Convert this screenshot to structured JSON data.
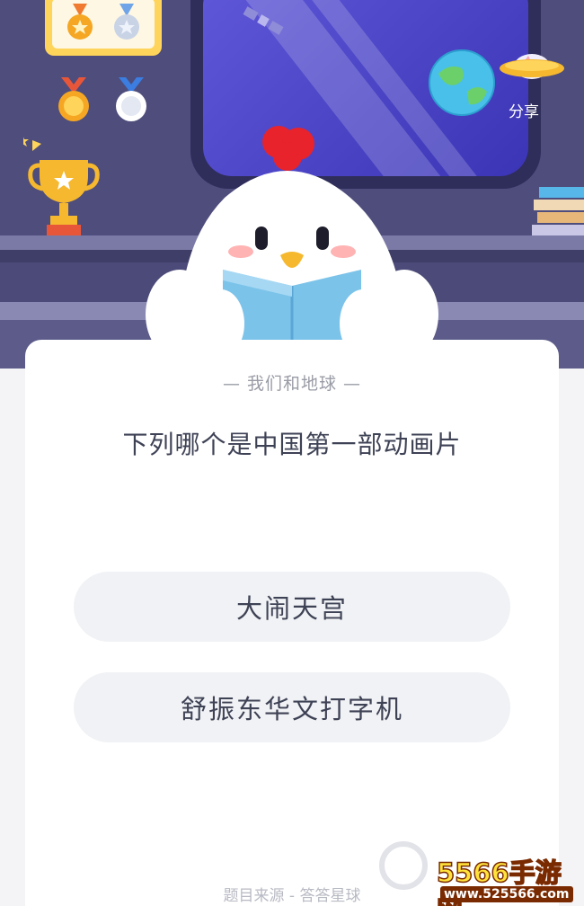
{
  "scene": {
    "share_label": "分享",
    "icons": [
      "bronze-medal-icon",
      "silver-medal-icon",
      "trophy-icon",
      "earth-icon",
      "ufo-icon",
      "satellite-icon",
      "books-icon"
    ]
  },
  "quiz": {
    "category": "我们和地球",
    "question": "下列哪个是中国第一部动画片",
    "options": [
      "大闹天宫",
      "舒振东华文打字机"
    ],
    "source": "题目来源 - 答答星球"
  },
  "watermark": {
    "brand": "5566手游网",
    "url": "www.525566.com"
  },
  "colors": {
    "background": "#f4f4f7",
    "scene": "#4b4a78",
    "window_glass": "#5f58d8",
    "card": "#ffffff",
    "option": "#f1f2f5",
    "text": "#3e4255",
    "muted": "#9a9ca6"
  }
}
